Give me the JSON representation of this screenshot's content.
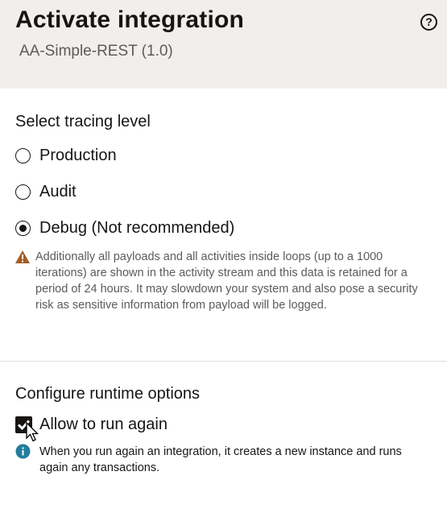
{
  "header": {
    "title": "Activate integration",
    "subtitle": "AA-Simple-REST (1.0)",
    "help_glyph": "?"
  },
  "tracing": {
    "heading": "Select tracing level",
    "options": [
      {
        "label": "Production",
        "selected": false
      },
      {
        "label": "Audit",
        "selected": false
      },
      {
        "label": "Debug (Not recommended)",
        "selected": true
      }
    ],
    "warning_lines": [
      "Additionally all payloads and all activities inside loops (up to a 1000",
      "iterations) are shown in the activity stream and this data is retained for a",
      "period of 24 hours. It may slowdown your system and also pose a security",
      "risk as sensitive information from payload will be logged."
    ]
  },
  "runtime": {
    "heading": "Configure runtime options",
    "checkbox_label": "Allow to run again",
    "checked": true,
    "info_lines": [
      "When you run again an integration, it creates a new instance and runs",
      "again any transactions."
    ]
  },
  "icons": {
    "help": "help-circle-icon",
    "warning": "warning-triangle-icon",
    "info": "info-circle-icon",
    "checkmark": "checkmark-icon",
    "cursor": "mouse-pointer-icon"
  },
  "colors": {
    "header_bg": "#f1efed",
    "warning": "#a15d26",
    "info": "#227e9e",
    "text": "#161513",
    "muted_text": "#5d5b58"
  }
}
